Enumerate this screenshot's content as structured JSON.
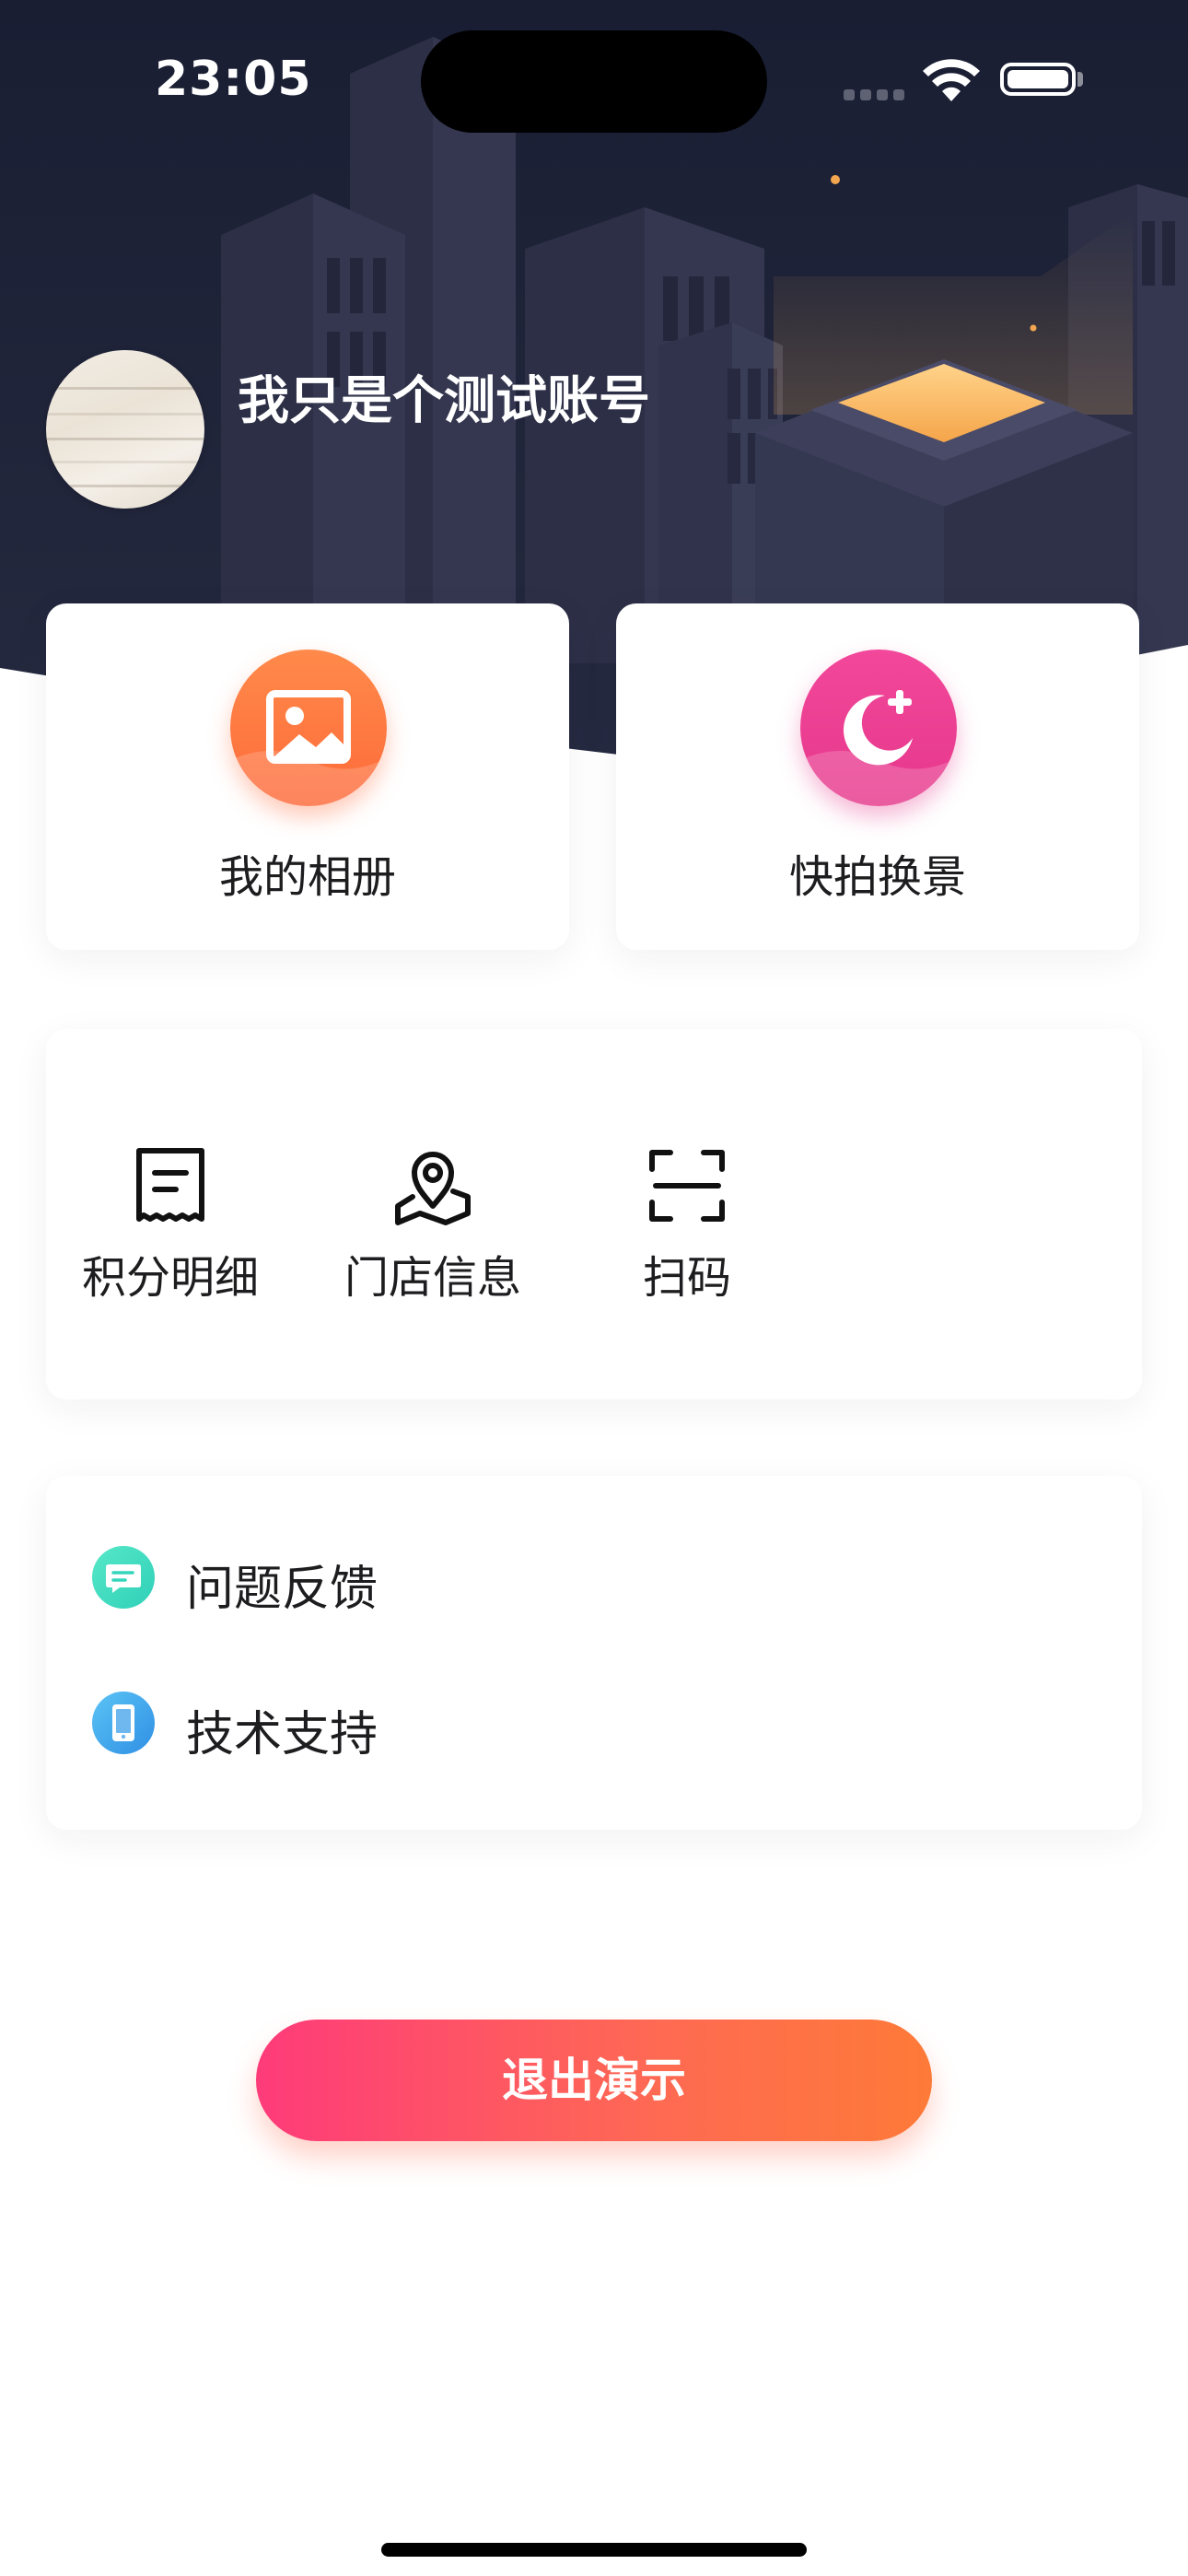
{
  "status_bar": {
    "time": "23:05"
  },
  "profile": {
    "username": "我只是个测试账号"
  },
  "quick_actions": [
    {
      "label": "我的相册",
      "icon": "photo-album-icon",
      "color_start": "#ff8a4a",
      "color_end": "#fe6a3a"
    },
    {
      "label": "快拍换景",
      "icon": "moon-plus-icon",
      "color_start": "#f2479a",
      "color_end": "#e6388c"
    }
  ],
  "tools": [
    {
      "label": "积分明细",
      "icon": "receipt-icon"
    },
    {
      "label": "门店信息",
      "icon": "map-pin-icon"
    },
    {
      "label": "扫码",
      "icon": "scan-icon"
    }
  ],
  "support_items": [
    {
      "label": "问题反馈",
      "icon": "feedback-icon",
      "color": "#3ed9c0"
    },
    {
      "label": "技术支持",
      "icon": "phone-support-icon",
      "color": "#3ea6ee"
    }
  ],
  "logout": {
    "label": "退出演示"
  },
  "colors": {
    "header_bg": "#1b1f33",
    "accent_start": "#fe3b7a",
    "accent_end": "#fe7a38"
  }
}
